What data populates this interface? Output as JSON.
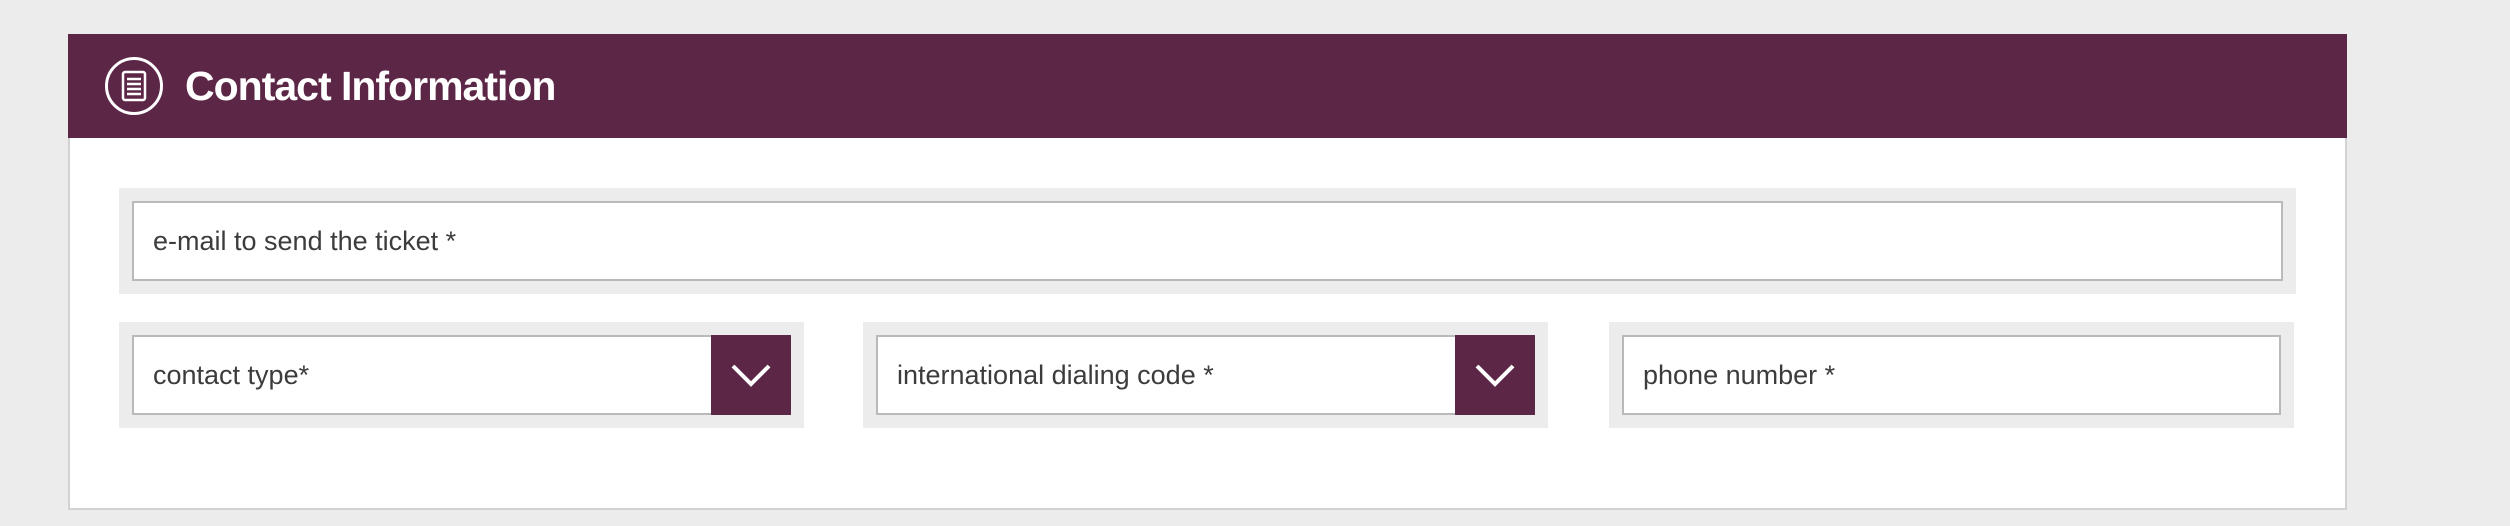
{
  "header": {
    "title": "Contact Information",
    "icon": "document-icon"
  },
  "form": {
    "email": {
      "placeholder": "e-mail  to send the ticket *"
    },
    "contact_type": {
      "placeholder": "contact type*",
      "icon": "chevron-down-icon"
    },
    "dialing_code": {
      "placeholder": "international dialing code *",
      "icon": "chevron-down-icon"
    },
    "phone": {
      "placeholder": "phone number *"
    }
  },
  "colors": {
    "brand": "#5c2646",
    "background": "#ececec",
    "field_border": "#b9b9b9"
  }
}
